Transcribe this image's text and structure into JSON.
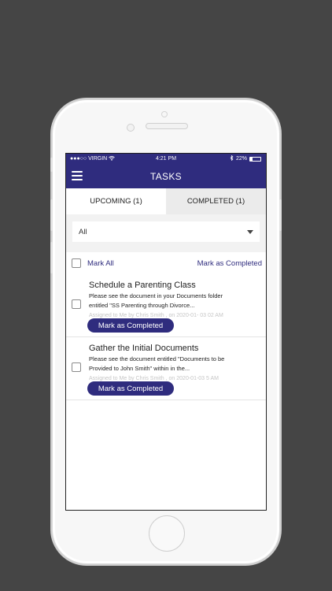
{
  "status": {
    "carrier": "●●●○○ VIRGIN",
    "wifi_icon": "wifi-icon",
    "time": "4:21 PM",
    "bluetooth_icon": "bluetooth-icon",
    "battery": "22%"
  },
  "nav": {
    "title": "TASKS",
    "menu_icon": "menu-icon"
  },
  "tabs": [
    {
      "label": "UPCOMING (1)",
      "active": true
    },
    {
      "label": "COMPLETED (1)",
      "active": false
    }
  ],
  "filter": {
    "selected": "All"
  },
  "markbar": {
    "mark_all": "Mark All",
    "mark_completed": "Mark as Completed"
  },
  "tasks": [
    {
      "title": "Schedule a Parenting Class",
      "description": "Please see the document in your Documents folder entitled \"SS Parenting through Divorce...",
      "meta": "Assigned to Me by Chris Smith , on 2020-01- 03 02 AM",
      "button": "Mark as Completed"
    },
    {
      "title": "Gather the Initial Documents",
      "description": "Please see the document entitled \"Documents to be Provided to John Smith\" within in the...",
      "meta": "Assigned to Me by Chris Smith , on 2020-01-03 5 AM",
      "button": "Mark as Completed"
    }
  ]
}
